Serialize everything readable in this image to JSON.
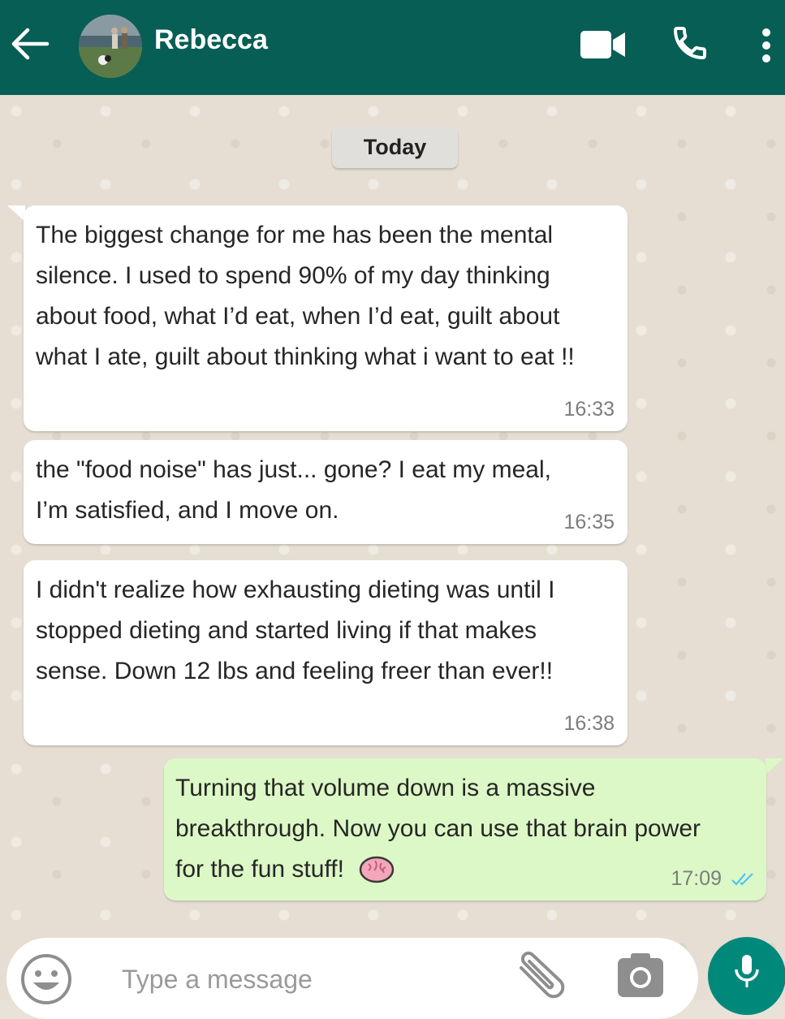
{
  "header": {
    "contact_name": "Rebecca",
    "icons": [
      "back-arrow-icon",
      "video-call-icon",
      "voice-call-icon",
      "more-vert-icon"
    ]
  },
  "date_separator": "Today",
  "messages": [
    {
      "direction": "incoming",
      "text": "The biggest change for me has been the mental silence. I used to spend 90% of my day thinking about food, what I’d eat, when I’d eat, guilt about what I ate, guilt about thinking what i want to eat !!",
      "time": "16:33"
    },
    {
      "direction": "incoming",
      "text": "the \"food noise\" has just... gone? I eat my meal, I’m satisfied, and I move on.",
      "time": "16:35"
    },
    {
      "direction": "incoming",
      "text": "I didn't realize how exhausting dieting was until I stopped dieting and started living if that makes sense. Down 12 lbs and feeling freer than ever!!",
      "time": "16:38"
    },
    {
      "direction": "outgoing",
      "text": "Turning that volume down is a massive breakthrough. Now you can use that brain power for the fun stuff!",
      "emoji": "brain-emoji",
      "time": "17:09",
      "status": "read"
    }
  ],
  "composer": {
    "placeholder": "Type a message",
    "icons": [
      "emoji-icon",
      "attach-icon",
      "camera-icon",
      "mic-icon"
    ]
  },
  "colors": {
    "header_bg": "#075e54",
    "incoming_bubble": "#ffffff",
    "outgoing_bubble": "#dcf8c6",
    "mic_button": "#00897b",
    "read_ticks": "#4fc3f7"
  }
}
